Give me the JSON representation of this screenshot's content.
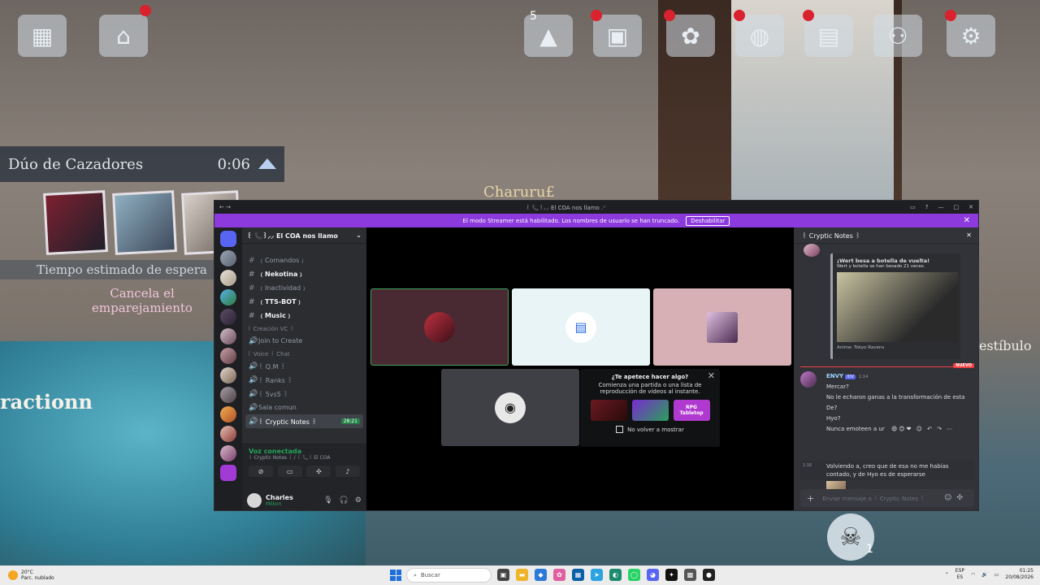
{
  "game": {
    "hud_badge": "5",
    "match_panel": {
      "title": "Dúo de Cazadores",
      "timer": "0:06"
    },
    "wait_label": "Tiempo estimado de espera",
    "cancel_label": "Cancela el emparejamiento",
    "player_name": "Charuru£",
    "left_text": "ractionn",
    "right_text": "estíbulo",
    "skull_count": "1"
  },
  "discord": {
    "window_title": "꒰ 📞꒱⸝⸝ El COA nos llamo .ᐟ",
    "streamer_banner": "El modo Streamer está habilitado. Los nombres de usuario se han truncado.",
    "streamer_button": "Deshabilitar",
    "server_name": "꒰ 📞꒱⸝⸝ El COA nos llamo",
    "channels": [
      {
        "name": "﹙Comandos﹚",
        "bold": false
      },
      {
        "name": "﹙Nekotina﹚",
        "bold": true
      },
      {
        "name": "﹙Inactividad﹚",
        "bold": false
      },
      {
        "name": "﹙TTS-BOT﹚",
        "bold": true
      },
      {
        "name": "﹙Music﹚",
        "bold": true
      }
    ],
    "cat_creation": "꒰ Creación VC ꒱",
    "join_to_create": "Join to Create",
    "cat_voice": "꒰ Voice ꒱ Chat",
    "voice_channels": [
      "꒰ Q.M ꒱",
      "꒰ Ranks ꒱",
      "꒰ 5vs5 ꒱",
      "Sala comun"
    ],
    "active_channel": "꒰ Cryptic Notes ꒱",
    "active_time": "28:21",
    "voice_connected": "Voz conectada",
    "voice_sub": "꒰ Cryptic Notes ꒱ / ꒰ 📞꒱ El COA",
    "user_name": "Charles",
    "user_status": "Milkon",
    "prompt": {
      "title": "¿Te apetece hacer algo?",
      "body": "Comienza una partida o una lista de reproducción de vídeos al instante.",
      "act3": "RPG Tabletop",
      "checkbox": "No volver a mostrar"
    },
    "chat": {
      "channel": "꒰ Cryptic Notes ꒱",
      "embed_title": "¡Wert besa a botella de vuelta!",
      "embed_sub": "Wert y botella se han besado 21 veces.",
      "embed_caption": "Anime: Tokyo Ravens",
      "new_label": "NUEVO",
      "author": "ENVY",
      "author_tag": "IDV",
      "timestamp": "1:14",
      "messages": [
        "Mercar?",
        "No le echaron ganas a la transformación de esta",
        "De?",
        "Hyo?",
        "Nunca emoteen a ur"
      ],
      "hover_ts": "1:16",
      "hover_msg1": "Volviendo a, creo que de esa no me habías",
      "hover_msg2": "contado, y de Hyo es de esperarse",
      "input_placeholder": "Enviar mensaje a ꒰ Cryptic Notes ꒱"
    }
  },
  "taskbar": {
    "temp": "20°C",
    "weather": "Parc. nublado",
    "search": "Buscar",
    "lang1": "ESP",
    "lang2": "ES",
    "time": "01:25",
    "date": "20/08/2026"
  }
}
